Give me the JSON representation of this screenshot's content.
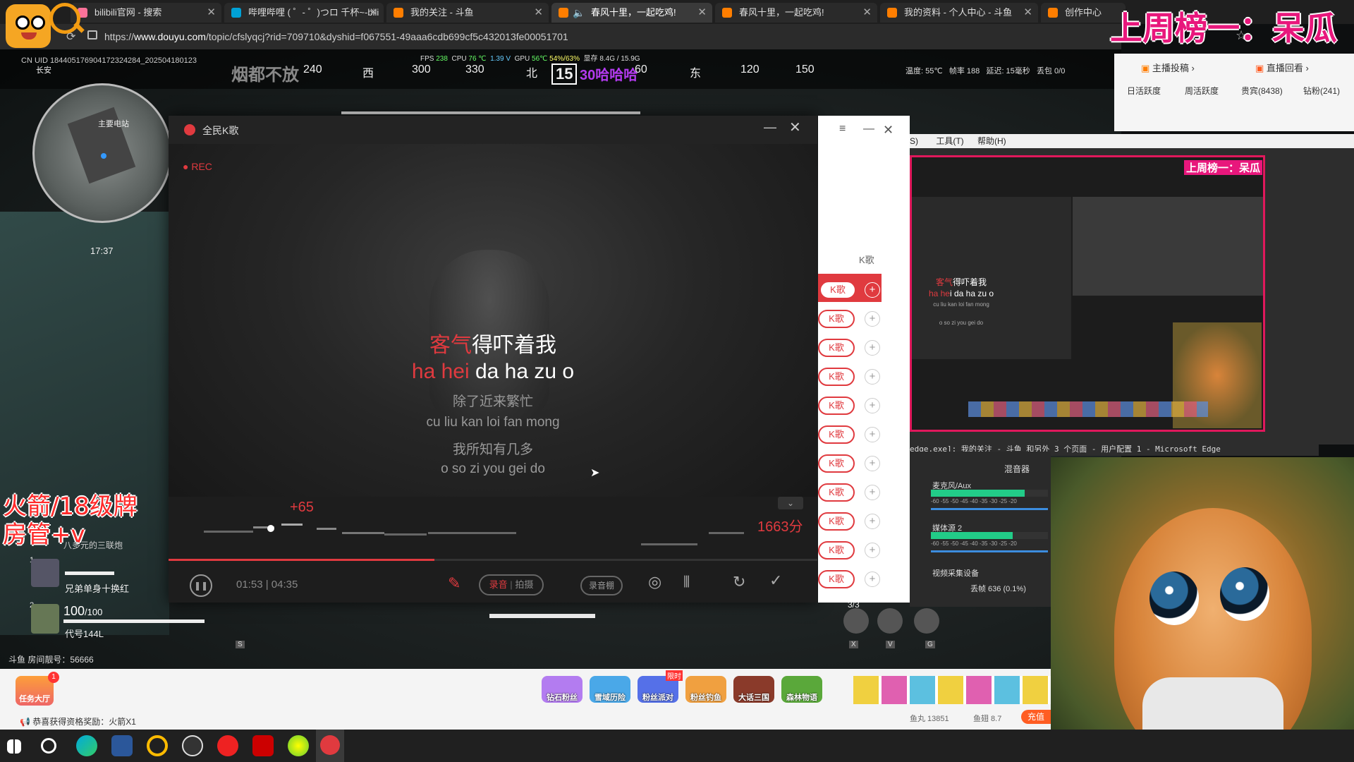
{
  "browser": {
    "tabs": [
      {
        "label": "bilibili官网 - 搜索",
        "color": "#fb7299"
      },
      {
        "label": "哔哩哔哩 ( ゜- ゜)つロ 千杯~-bili",
        "color": "#00a1d6"
      },
      {
        "label": "我的关注 - 斗鱼",
        "color": "#ff7e00"
      },
      {
        "label": "春风十里，一起吃鸡!",
        "color": "#ff7e00"
      },
      {
        "label": "春风十里，一起吃鸡!",
        "color": "#ff7e00"
      },
      {
        "label": "我的资料 - 个人中心 - 斗鱼",
        "color": "#ff7e00"
      },
      {
        "label": "创作中心",
        "color": "#ff7e00"
      }
    ],
    "url_prefix": "https://",
    "url_host": "www.douyu.com",
    "url_path": "/topic/cfslyqcj?rid=709710&dyshid=f067551-49aaa6cdb699cf5c432013fe00051701"
  },
  "ranking_overlay": "上周榜一：呆瓜",
  "game_hud": {
    "uid": "CN UID 18440517690417232428​4_202504180123",
    "overlay_text": "烟都不放",
    "fps_label": "FPS",
    "fps": "238",
    "cpu_label": "CPU",
    "cpu_temp": "76 ℃",
    "voltage": "1.39 V",
    "gpu_label": "GPU",
    "gpu_temp": "56℃",
    "gpu_usage": "54%/63%",
    "vram_label": "显存",
    "vram": "8.4G / 15.9G",
    "compass": [
      "240",
      "西",
      "300",
      "330",
      "北",
      "15",
      "60",
      "东",
      "120",
      "150"
    ],
    "compass_overlay": "30哈哈哈",
    "stats": "温度: 55℃   帧率 188   延迟: 15毫秒   丢包 0/0",
    "minimap_label": "主要电站",
    "minimap_place": "长安",
    "clock": "17:37",
    "player1_weapon": "八多元的三联炮",
    "player1_num": "1",
    "player1_name": "兄弟单身十换红",
    "player2_num": "2",
    "health": "100",
    "health_max": "/100",
    "player2_name": "代号144L",
    "room_number": "斗鱼 房间靓号：56666",
    "red_overlay_line1": "火箭/18级牌",
    "red_overlay_line2": "房管+v",
    "ammo_counter": "3/3",
    "slot_keys": [
      "S",
      "X",
      "V",
      "G"
    ]
  },
  "karaoke": {
    "title": "全民K歌",
    "rec": "REC",
    "lyric_line1_hl": "客气",
    "lyric_line1_rest": "得吓着我",
    "lyric_line2_hl": "ha hei",
    "lyric_line2_rest": " da ha zu o",
    "lyric_line3": "除了近来繁忙",
    "lyric_line4": "cu liu kan loi fan mong",
    "lyric_line5": "我所知有几多",
    "lyric_line6": "o so zi you gei do",
    "combo": "+65",
    "score": "1663分",
    "time": "01:53 | 04:35",
    "record_label": "录音",
    "shoot_label": "拍摄",
    "studio_label": "录音棚",
    "progress": 0.41
  },
  "songlist": {
    "header": "K歌",
    "buttons": [
      "K歌",
      "K歌",
      "K歌",
      "K歌",
      "K歌",
      "K歌",
      "K歌",
      "K歌",
      "K歌",
      "K歌",
      "K歌"
    ],
    "partial_label": "S)",
    "menus": [
      "工具(T)",
      "帮助(H)"
    ]
  },
  "obs": {
    "preview_ranking": "上周榜一：呆瓜",
    "preview_lyric1_hl": "客气",
    "preview_lyric1_rest": "得吓着我",
    "preview_lyric2_hl": "ha he",
    "preview_lyric2_rest": "i da ha zu o",
    "preview_lyric3": "cu liu kan loi fan mong",
    "preview_lyric4": "o so zi you gei do",
    "window_title": "edge.exe]: 我的关注 - 斗鱼 和另外 3 个页面 - 用户配置 1 - Microsoft Edge",
    "mixer_title": "混音器",
    "mixer_tracks": [
      "麦克风/Aux",
      "媒体源 2",
      "视频采集设备"
    ],
    "mixer_scale": "-60 -55 -50 -45 -40 -35 -30 -25 -20",
    "dropped_frames": "丢帧 636 (0.1%)"
  },
  "douyu_panel": {
    "anchor_btn": "主播投稿 ›",
    "replay_btn": "直播回看 ›",
    "tabs": [
      "日活跃度",
      "周活跃度",
      "贵宾(8438)",
      "钻粉(241)"
    ]
  },
  "giftbar": {
    "task_label": "任务大厅",
    "task_badge": "1",
    "notice": "恭喜获得资格奖励：火箭X1",
    "gifts": [
      "钻石粉丝",
      "雪域历险",
      "粉丝派对",
      "粉丝钓鱼",
      "大话三国",
      "森林物语"
    ],
    "limited_badge": "限时",
    "yuwan": "鱼丸 13851",
    "yuchi": "鱼翅 8.7",
    "charge": "充值"
  },
  "taskbar_apps": [
    "windows-start",
    "search",
    "edge",
    "word",
    "browser-orange",
    "obs",
    "netease-music",
    "app-red",
    "app-yellow",
    "kge-app"
  ],
  "colors": {
    "karaoke_red": "#e03a3f",
    "ranking_pink": "#e8177c",
    "obs_preview_border": "#e0185c",
    "overlay_red": "#ff2a2a"
  }
}
